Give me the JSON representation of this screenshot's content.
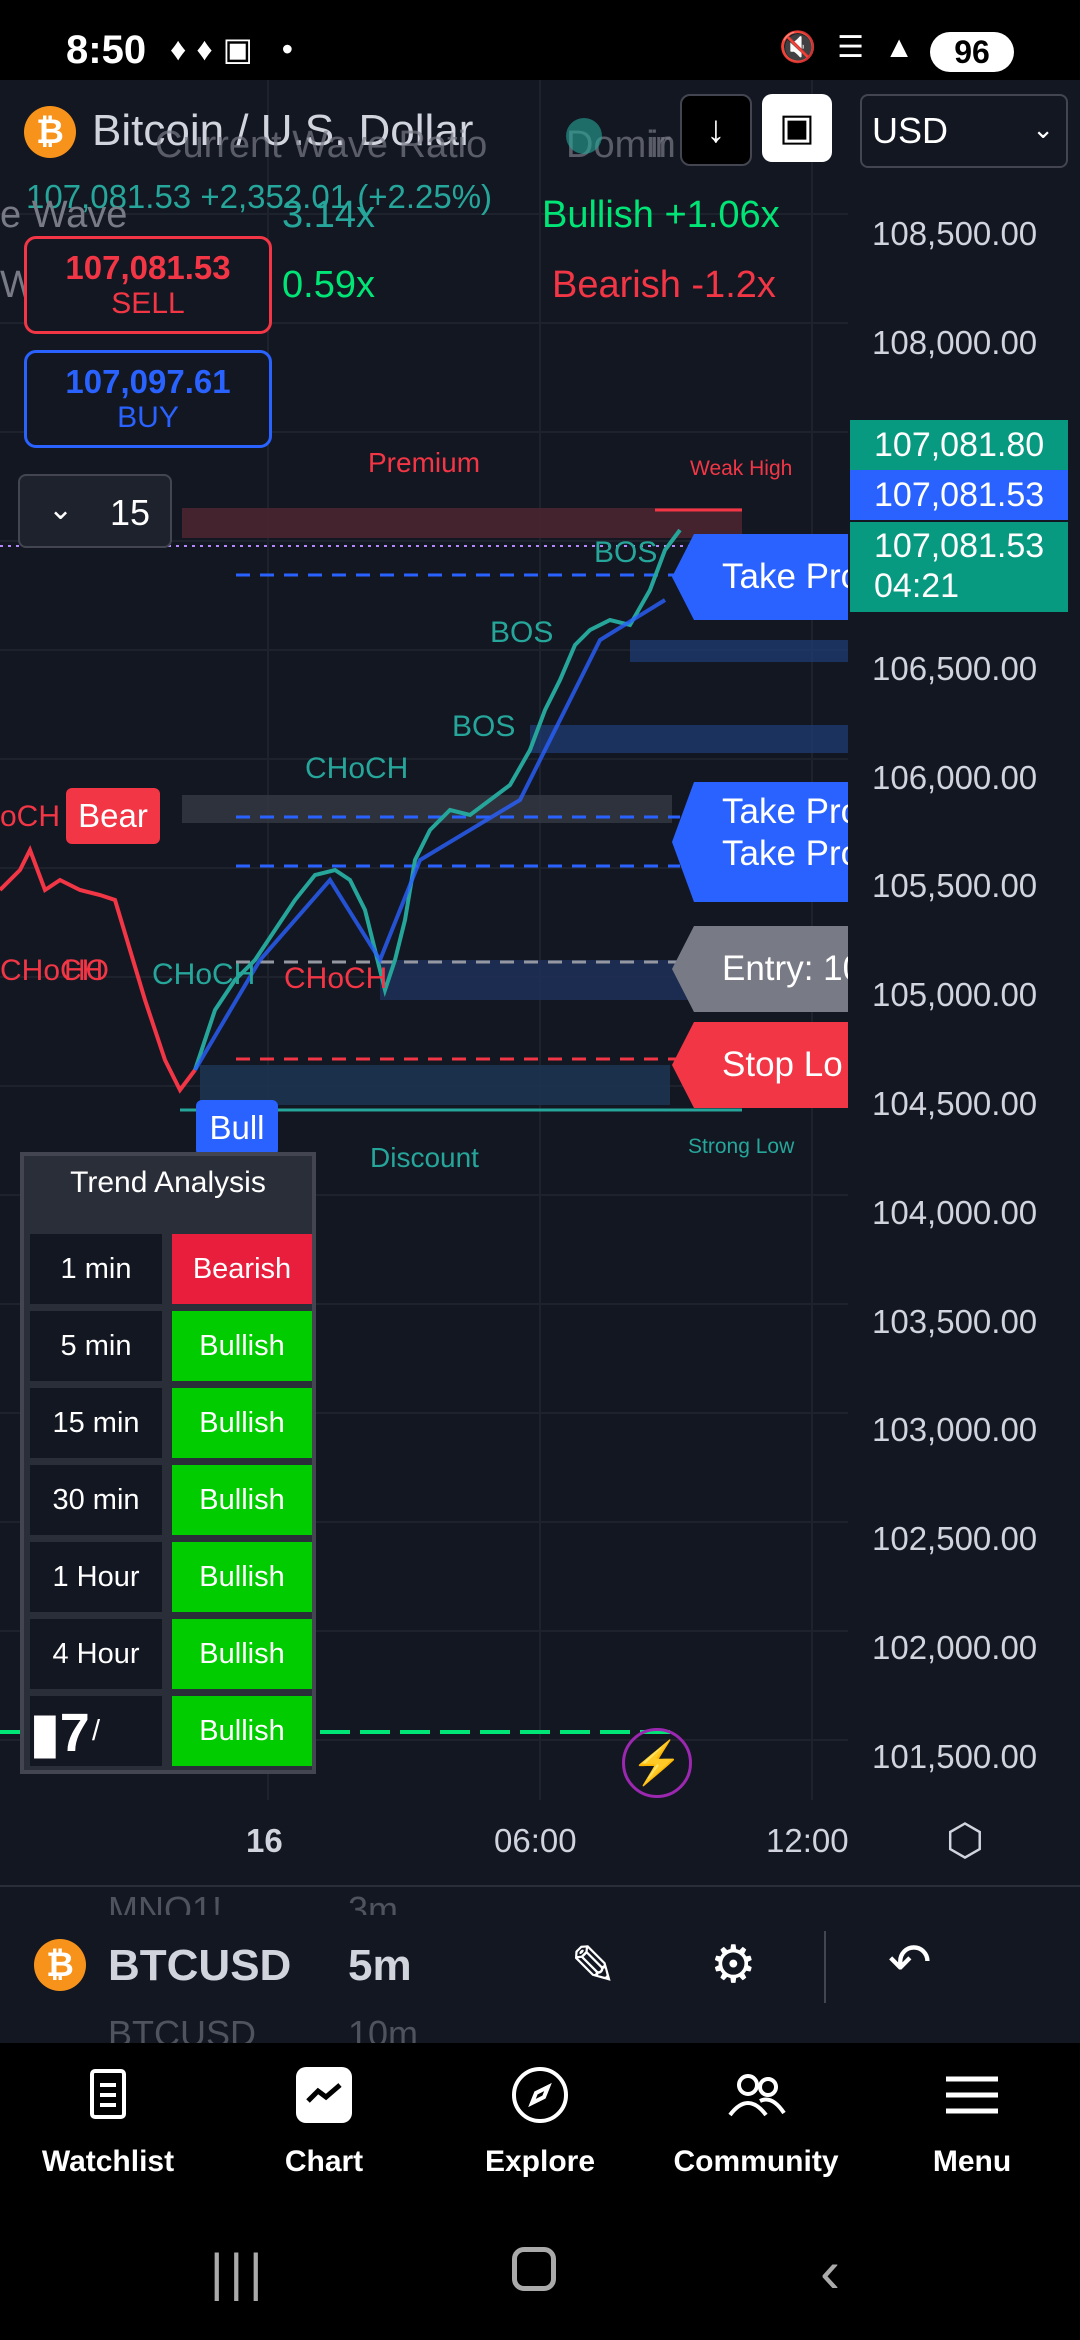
{
  "status_bar": {
    "time": "8:50",
    "battery": "96"
  },
  "header": {
    "symbol_title": "Bitcoin / U.S. Dollar",
    "price_line": "107,081.53  +2,352.01 (+2.25%)",
    "currency": "USD",
    "sell_price": "107,081.53",
    "sell_label": "SELL",
    "buy_price": "107,097.61",
    "buy_label": "BUY",
    "interval_value": "15"
  },
  "wave_overlay": {
    "title": "Current Wave Ratio",
    "title2": "Domin",
    "title3": "ir",
    "row1_label": "e Wave",
    "row1_value": "3.14x",
    "row1_dom": "Bullish +1.06x",
    "row2_label": "W",
    "row2_value": "0.59x",
    "row2_dom": "Bearish -1.2x"
  },
  "price_axis": [
    "108,500.00",
    "108,000.00",
    "106,500.00",
    "106,000.00",
    "105,500.00",
    "105,000.00",
    "104,500.00",
    "104,000.00",
    "103,500.00",
    "103,000.00",
    "102,500.00",
    "102,000.00",
    "101,500.00"
  ],
  "price_tags": {
    "green": "107,081.80",
    "blue": "107,081.53",
    "countdown_price": "107,081.53",
    "countdown_time": "04:21"
  },
  "chart_labels": {
    "premium": "Premium",
    "discount": "Discount",
    "weak_high": "Weak High",
    "strong_low": "Strong Low",
    "bos1": "BOS",
    "bos2": "BOS",
    "bos3": "BOS",
    "choch1": "CHoCH",
    "choch2": "CHoCH",
    "choch3": "CHoCH",
    "choch_left": "oCH",
    "choch_left2": "CHoCH",
    "choch_left3": "HO",
    "bear": "Bear",
    "bull": "Bull"
  },
  "order_tags": {
    "take_profit_1": "Take Pro",
    "take_profit_2": "Take Pro",
    "take_profit_3": "Take Pro",
    "entry": "Entry: 10",
    "stop_loss": "Stop Lo"
  },
  "trend_analysis": {
    "title": "Trend Analysis",
    "rows": [
      {
        "tf": "1 min",
        "status": "Bearish",
        "color": "#e91e3c"
      },
      {
        "tf": "5 min",
        "status": "Bullish",
        "color": "#00cc00"
      },
      {
        "tf": "15 min",
        "status": "Bullish",
        "color": "#00cc00"
      },
      {
        "tf": "30 min",
        "status": "Bullish",
        "color": "#00cc00"
      },
      {
        "tf": "1 Hour",
        "status": "Bullish",
        "color": "#00cc00"
      },
      {
        "tf": "4 Hour",
        "status": "Bullish",
        "color": "#00cc00"
      },
      {
        "tf": "/",
        "status": "Bullish",
        "color": "#00cc00"
      }
    ]
  },
  "time_axis": {
    "t1": "16",
    "t2": "06:00",
    "t3": "12:00"
  },
  "bottom_toolbar": {
    "symbol": "BTCUSD",
    "interval": "5m",
    "ghost_symbol_top": "MNQ1!",
    "ghost_interval_top": "3m",
    "ghost_symbol_bottom": "BTCUSD",
    "ghost_interval_bottom": "10m"
  },
  "nav": {
    "watchlist": "Watchlist",
    "chart": "Chart",
    "explore": "Explore",
    "community": "Community",
    "menu": "Menu"
  },
  "colors": {
    "bg": "#131722",
    "bull": "#26a69a",
    "bear": "#f23645",
    "blue": "#2962ff",
    "bullish_cell": "#00cc00",
    "bearish_cell": "#e91e3c"
  }
}
